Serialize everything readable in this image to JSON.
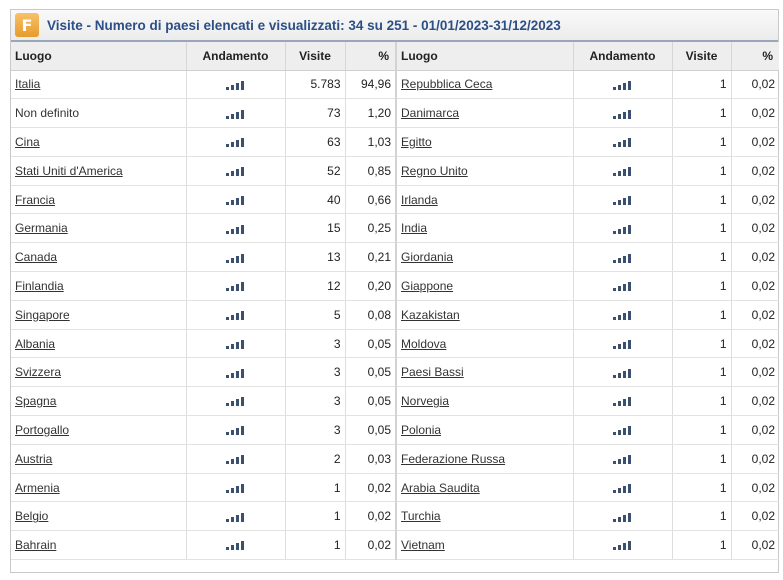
{
  "header": {
    "logo_letter": "F",
    "title": "Visite - Numero di paesi elencati e visualizzati: 34 su 251 - 01/01/2023-31/12/2023"
  },
  "columns": {
    "luogo": "Luogo",
    "andamento": "Andamento",
    "visite": "Visite",
    "pct": "%"
  },
  "colors": {
    "title": "#2c4f86",
    "spark": "#3b4f6e",
    "header_bg": "#eeeeee"
  },
  "left_rows": [
    {
      "name": "Italia",
      "link": true,
      "visite": "5.783",
      "pct": "94,96"
    },
    {
      "name": "Non definito",
      "link": false,
      "visite": "73",
      "pct": "1,20"
    },
    {
      "name": "Cina",
      "link": true,
      "visite": "63",
      "pct": "1,03"
    },
    {
      "name": "Stati Uniti d'America",
      "link": true,
      "visite": "52",
      "pct": "0,85"
    },
    {
      "name": "Francia",
      "link": true,
      "visite": "40",
      "pct": "0,66"
    },
    {
      "name": "Germania",
      "link": true,
      "visite": "15",
      "pct": "0,25"
    },
    {
      "name": "Canada",
      "link": true,
      "visite": "13",
      "pct": "0,21"
    },
    {
      "name": "Finlandia",
      "link": true,
      "visite": "12",
      "pct": "0,20"
    },
    {
      "name": "Singapore",
      "link": true,
      "visite": "5",
      "pct": "0,08"
    },
    {
      "name": "Albania",
      "link": true,
      "visite": "3",
      "pct": "0,05"
    },
    {
      "name": "Svizzera",
      "link": true,
      "visite": "3",
      "pct": "0,05"
    },
    {
      "name": "Spagna",
      "link": true,
      "visite": "3",
      "pct": "0,05"
    },
    {
      "name": "Portogallo",
      "link": true,
      "visite": "3",
      "pct": "0,05"
    },
    {
      "name": "Austria",
      "link": true,
      "visite": "2",
      "pct": "0,03"
    },
    {
      "name": "Armenia",
      "link": true,
      "visite": "1",
      "pct": "0,02"
    },
    {
      "name": "Belgio",
      "link": true,
      "visite": "1",
      "pct": "0,02"
    },
    {
      "name": "Bahrain",
      "link": true,
      "visite": "1",
      "pct": "0,02"
    }
  ],
  "right_rows": [
    {
      "name": "Repubblica Ceca",
      "link": true,
      "visite": "1",
      "pct": "0,02"
    },
    {
      "name": "Danimarca",
      "link": true,
      "visite": "1",
      "pct": "0,02"
    },
    {
      "name": "Egitto",
      "link": true,
      "visite": "1",
      "pct": "0,02"
    },
    {
      "name": "Regno Unito",
      "link": true,
      "visite": "1",
      "pct": "0,02"
    },
    {
      "name": "Irlanda",
      "link": true,
      "visite": "1",
      "pct": "0,02"
    },
    {
      "name": "India",
      "link": true,
      "visite": "1",
      "pct": "0,02"
    },
    {
      "name": "Giordania",
      "link": true,
      "visite": "1",
      "pct": "0,02"
    },
    {
      "name": "Giappone",
      "link": true,
      "visite": "1",
      "pct": "0,02"
    },
    {
      "name": "Kazakistan",
      "link": true,
      "visite": "1",
      "pct": "0,02"
    },
    {
      "name": "Moldova",
      "link": true,
      "visite": "1",
      "pct": "0,02"
    },
    {
      "name": "Paesi Bassi",
      "link": true,
      "visite": "1",
      "pct": "0,02"
    },
    {
      "name": "Norvegia",
      "link": true,
      "visite": "1",
      "pct": "0,02"
    },
    {
      "name": "Polonia",
      "link": true,
      "visite": "1",
      "pct": "0,02"
    },
    {
      "name": "Federazione Russa",
      "link": true,
      "visite": "1",
      "pct": "0,02"
    },
    {
      "name": "Arabia Saudita",
      "link": true,
      "visite": "1",
      "pct": "0,02"
    },
    {
      "name": "Turchia",
      "link": true,
      "visite": "1",
      "pct": "0,02"
    },
    {
      "name": "Vietnam",
      "link": true,
      "visite": "1",
      "pct": "0,02"
    }
  ]
}
